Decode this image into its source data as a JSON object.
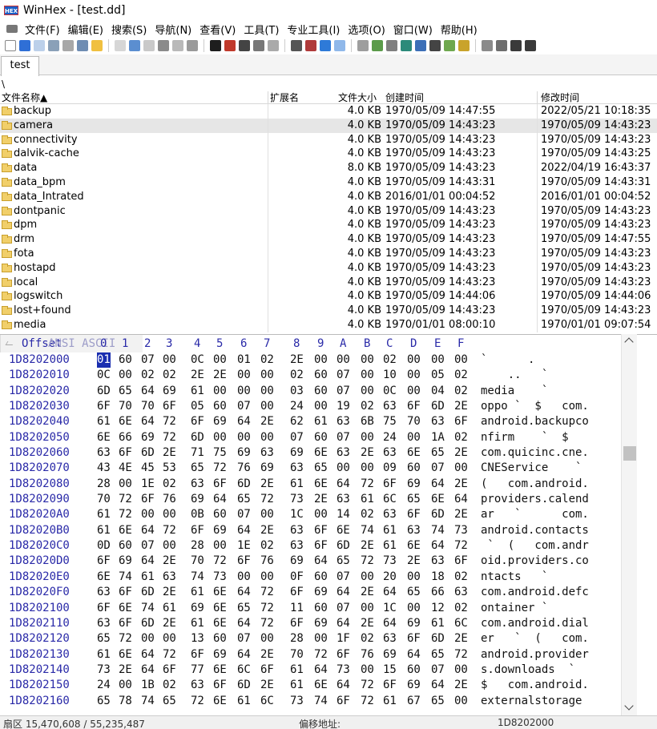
{
  "window": {
    "title": "WinHex - [test.dd]",
    "app_icon_text": "HEX"
  },
  "menu": [
    "文件(F)",
    "编辑(E)",
    "搜索(S)",
    "导航(N)",
    "查看(V)",
    "工具(T)",
    "专业工具(I)",
    "选项(O)",
    "窗口(W)",
    "帮助(H)"
  ],
  "tab": {
    "label": "test"
  },
  "path": "\\",
  "dir_header": {
    "name": "文件名称▲",
    "ext": "扩展名",
    "size": "文件大小",
    "created": "创建时间",
    "modified": "修改时间"
  },
  "dir_rows": [
    {
      "name": "backup",
      "size": "4.0 KB",
      "created": "1970/05/09  14:47:55",
      "modified": "2022/05/21  10:18:35"
    },
    {
      "name": "camera",
      "size": "4.0 KB",
      "created": "1970/05/09  14:43:23",
      "modified": "1970/05/09  14:43:23",
      "selected": true
    },
    {
      "name": "connectivity",
      "size": "4.0 KB",
      "created": "1970/05/09  14:43:23",
      "modified": "1970/05/09  14:43:23"
    },
    {
      "name": "dalvik-cache",
      "size": "4.0 KB",
      "created": "1970/05/09  14:43:23",
      "modified": "1970/05/09  14:43:25"
    },
    {
      "name": "data",
      "size": "8.0 KB",
      "created": "1970/05/09  14:43:23",
      "modified": "2022/04/19  16:43:37"
    },
    {
      "name": "data_bpm",
      "size": "4.0 KB",
      "created": "1970/05/09  14:43:31",
      "modified": "1970/05/09  14:43:31"
    },
    {
      "name": "data_Intrated",
      "size": "4.0 KB",
      "created": "2016/01/01  00:04:52",
      "modified": "2016/01/01  00:04:52"
    },
    {
      "name": "dontpanic",
      "size": "4.0 KB",
      "created": "1970/05/09  14:43:23",
      "modified": "1970/05/09  14:43:23"
    },
    {
      "name": "dpm",
      "size": "4.0 KB",
      "created": "1970/05/09  14:43:23",
      "modified": "1970/05/09  14:43:23"
    },
    {
      "name": "drm",
      "size": "4.0 KB",
      "created": "1970/05/09  14:43:23",
      "modified": "1970/05/09  14:47:55"
    },
    {
      "name": "fota",
      "size": "4.0 KB",
      "created": "1970/05/09  14:43:23",
      "modified": "1970/05/09  14:43:23"
    },
    {
      "name": "hostapd",
      "size": "4.0 KB",
      "created": "1970/05/09  14:43:23",
      "modified": "1970/05/09  14:43:23"
    },
    {
      "name": "local",
      "size": "4.0 KB",
      "created": "1970/05/09  14:43:23",
      "modified": "1970/05/09  14:43:23"
    },
    {
      "name": "logswitch",
      "size": "4.0 KB",
      "created": "1970/05/09  14:44:06",
      "modified": "1970/05/09  14:44:06"
    },
    {
      "name": "lost+found",
      "size": "4.0 KB",
      "created": "1970/05/09  14:43:23",
      "modified": "1970/05/09  14:43:23"
    },
    {
      "name": "media",
      "size": "4.0 KB",
      "created": "1970/01/01  08:00:10",
      "modified": "1970/01/01  09:07:54"
    }
  ],
  "hex": {
    "offset_label": "Offset",
    "columns": [
      "0",
      "1",
      "2",
      "3",
      "4",
      "5",
      "6",
      "7",
      "8",
      "9",
      "A",
      "B",
      "C",
      "D",
      "E",
      "F"
    ],
    "ansi_label": "ANSI ASCII",
    "rows": [
      {
        "off": "1D8202000",
        "bytes": [
          "01",
          "60",
          "07",
          "00",
          "0C",
          "00",
          "01",
          "02",
          "2E",
          "00",
          "00",
          "00",
          "02",
          "00",
          "00",
          "00"
        ],
        "ansi": "`      .        "
      },
      {
        "off": "1D8202010",
        "bytes": [
          "0C",
          "00",
          "02",
          "02",
          "2E",
          "2E",
          "00",
          "00",
          "02",
          "60",
          "07",
          "00",
          "10",
          "00",
          "05",
          "02"
        ],
        "ansi": "    ..   `      "
      },
      {
        "off": "1D8202020",
        "bytes": [
          "6D",
          "65",
          "64",
          "69",
          "61",
          "00",
          "00",
          "00",
          "03",
          "60",
          "07",
          "00",
          "0C",
          "00",
          "04",
          "02"
        ],
        "ansi": "media    `      "
      },
      {
        "off": "1D8202030",
        "bytes": [
          "6F",
          "70",
          "70",
          "6F",
          "05",
          "60",
          "07",
          "00",
          "24",
          "00",
          "19",
          "02",
          "63",
          "6F",
          "6D",
          "2E"
        ],
        "ansi": "oppo `  $   com."
      },
      {
        "off": "1D8202040",
        "bytes": [
          "61",
          "6E",
          "64",
          "72",
          "6F",
          "69",
          "64",
          "2E",
          "62",
          "61",
          "63",
          "6B",
          "75",
          "70",
          "63",
          "6F"
        ],
        "ansi": "android.backupco"
      },
      {
        "off": "1D8202050",
        "bytes": [
          "6E",
          "66",
          "69",
          "72",
          "6D",
          "00",
          "00",
          "00",
          "07",
          "60",
          "07",
          "00",
          "24",
          "00",
          "1A",
          "02"
        ],
        "ansi": "nfirm    `  $   "
      },
      {
        "off": "1D8202060",
        "bytes": [
          "63",
          "6F",
          "6D",
          "2E",
          "71",
          "75",
          "69",
          "63",
          "69",
          "6E",
          "63",
          "2E",
          "63",
          "6E",
          "65",
          "2E"
        ],
        "ansi": "com.quicinc.cne."
      },
      {
        "off": "1D8202070",
        "bytes": [
          "43",
          "4E",
          "45",
          "53",
          "65",
          "72",
          "76",
          "69",
          "63",
          "65",
          "00",
          "00",
          "09",
          "60",
          "07",
          "00"
        ],
        "ansi": "CNEService    `  "
      },
      {
        "off": "1D8202080",
        "bytes": [
          "28",
          "00",
          "1E",
          "02",
          "63",
          "6F",
          "6D",
          "2E",
          "61",
          "6E",
          "64",
          "72",
          "6F",
          "69",
          "64",
          "2E"
        ],
        "ansi": "(   com.android."
      },
      {
        "off": "1D8202090",
        "bytes": [
          "70",
          "72",
          "6F",
          "76",
          "69",
          "64",
          "65",
          "72",
          "73",
          "2E",
          "63",
          "61",
          "6C",
          "65",
          "6E",
          "64"
        ],
        "ansi": "providers.calend"
      },
      {
        "off": "1D82020A0",
        "bytes": [
          "61",
          "72",
          "00",
          "00",
          "0B",
          "60",
          "07",
          "00",
          "1C",
          "00",
          "14",
          "02",
          "63",
          "6F",
          "6D",
          "2E"
        ],
        "ansi": "ar   `      com."
      },
      {
        "off": "1D82020B0",
        "bytes": [
          "61",
          "6E",
          "64",
          "72",
          "6F",
          "69",
          "64",
          "2E",
          "63",
          "6F",
          "6E",
          "74",
          "61",
          "63",
          "74",
          "73"
        ],
        "ansi": "android.contacts"
      },
      {
        "off": "1D82020C0",
        "bytes": [
          "0D",
          "60",
          "07",
          "00",
          "28",
          "00",
          "1E",
          "02",
          "63",
          "6F",
          "6D",
          "2E",
          "61",
          "6E",
          "64",
          "72"
        ],
        "ansi": " `  (   com.andr"
      },
      {
        "off": "1D82020D0",
        "bytes": [
          "6F",
          "69",
          "64",
          "2E",
          "70",
          "72",
          "6F",
          "76",
          "69",
          "64",
          "65",
          "72",
          "73",
          "2E",
          "63",
          "6F"
        ],
        "ansi": "oid.providers.co"
      },
      {
        "off": "1D82020E0",
        "bytes": [
          "6E",
          "74",
          "61",
          "63",
          "74",
          "73",
          "00",
          "00",
          "0F",
          "60",
          "07",
          "00",
          "20",
          "00",
          "18",
          "02"
        ],
        "ansi": "ntacts   `      "
      },
      {
        "off": "1D82020F0",
        "bytes": [
          "63",
          "6F",
          "6D",
          "2E",
          "61",
          "6E",
          "64",
          "72",
          "6F",
          "69",
          "64",
          "2E",
          "64",
          "65",
          "66",
          "63"
        ],
        "ansi": "com.android.defc"
      },
      {
        "off": "1D8202100",
        "bytes": [
          "6F",
          "6E",
          "74",
          "61",
          "69",
          "6E",
          "65",
          "72",
          "11",
          "60",
          "07",
          "00",
          "1C",
          "00",
          "12",
          "02"
        ],
        "ansi": "ontainer `      "
      },
      {
        "off": "1D8202110",
        "bytes": [
          "63",
          "6F",
          "6D",
          "2E",
          "61",
          "6E",
          "64",
          "72",
          "6F",
          "69",
          "64",
          "2E",
          "64",
          "69",
          "61",
          "6C"
        ],
        "ansi": "com.android.dial"
      },
      {
        "off": "1D8202120",
        "bytes": [
          "65",
          "72",
          "00",
          "00",
          "13",
          "60",
          "07",
          "00",
          "28",
          "00",
          "1F",
          "02",
          "63",
          "6F",
          "6D",
          "2E"
        ],
        "ansi": "er   `  (   com."
      },
      {
        "off": "1D8202130",
        "bytes": [
          "61",
          "6E",
          "64",
          "72",
          "6F",
          "69",
          "64",
          "2E",
          "70",
          "72",
          "6F",
          "76",
          "69",
          "64",
          "65",
          "72"
        ],
        "ansi": "android.provider"
      },
      {
        "off": "1D8202140",
        "bytes": [
          "73",
          "2E",
          "64",
          "6F",
          "77",
          "6E",
          "6C",
          "6F",
          "61",
          "64",
          "73",
          "00",
          "15",
          "60",
          "07",
          "00"
        ],
        "ansi": "s.downloads  `  "
      },
      {
        "off": "1D8202150",
        "bytes": [
          "24",
          "00",
          "1B",
          "02",
          "63",
          "6F",
          "6D",
          "2E",
          "61",
          "6E",
          "64",
          "72",
          "6F",
          "69",
          "64",
          "2E"
        ],
        "ansi": "$   com.android."
      },
      {
        "off": "1D8202160",
        "bytes": [
          "65",
          "78",
          "74",
          "65",
          "72",
          "6E",
          "61",
          "6C",
          "73",
          "74",
          "6F",
          "72",
          "61",
          "67",
          "65",
          "00"
        ],
        "ansi": "externalstorage "
      }
    ]
  },
  "status": {
    "sector": "扇区 15,470,608 / 55,235,487",
    "offset_label": "偏移地址:",
    "offset_value": "1D8202000"
  },
  "colors": {
    "offset": "#2a2aa8",
    "cursor": "#1a2eb0",
    "selection_row": "#e6e6e6"
  }
}
